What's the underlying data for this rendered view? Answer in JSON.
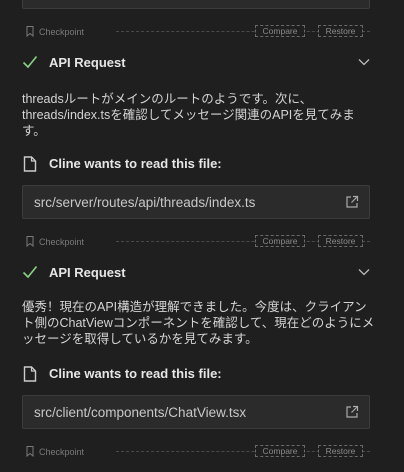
{
  "checkpoint": {
    "label": "Checkpoint",
    "compare_label": "Compare",
    "restore_label": "Restore"
  },
  "colors": {
    "background": "#1f1f1f",
    "success_check": "#89d185",
    "file_box_bg": "#2b2b2b"
  },
  "messages": [
    {
      "api_title": "API Request",
      "text": "threadsルートがメインのルートのようです。次に、threads/index.tsを確認してメッセージ関連のAPIを見てみます。",
      "tool_title": "Cline wants to read this file:",
      "file_path": "src/server/routes/api/threads/index.ts"
    },
    {
      "api_title": "API Request",
      "text": "優秀！現在のAPI構造が理解できました。今度は、クライアント側のChatViewコンポーネントを確認して、現在どのようにメッセージを取得しているかを見てみます。",
      "tool_title": "Cline wants to read this file:",
      "file_path": "src/client/components/ChatView.tsx"
    }
  ]
}
